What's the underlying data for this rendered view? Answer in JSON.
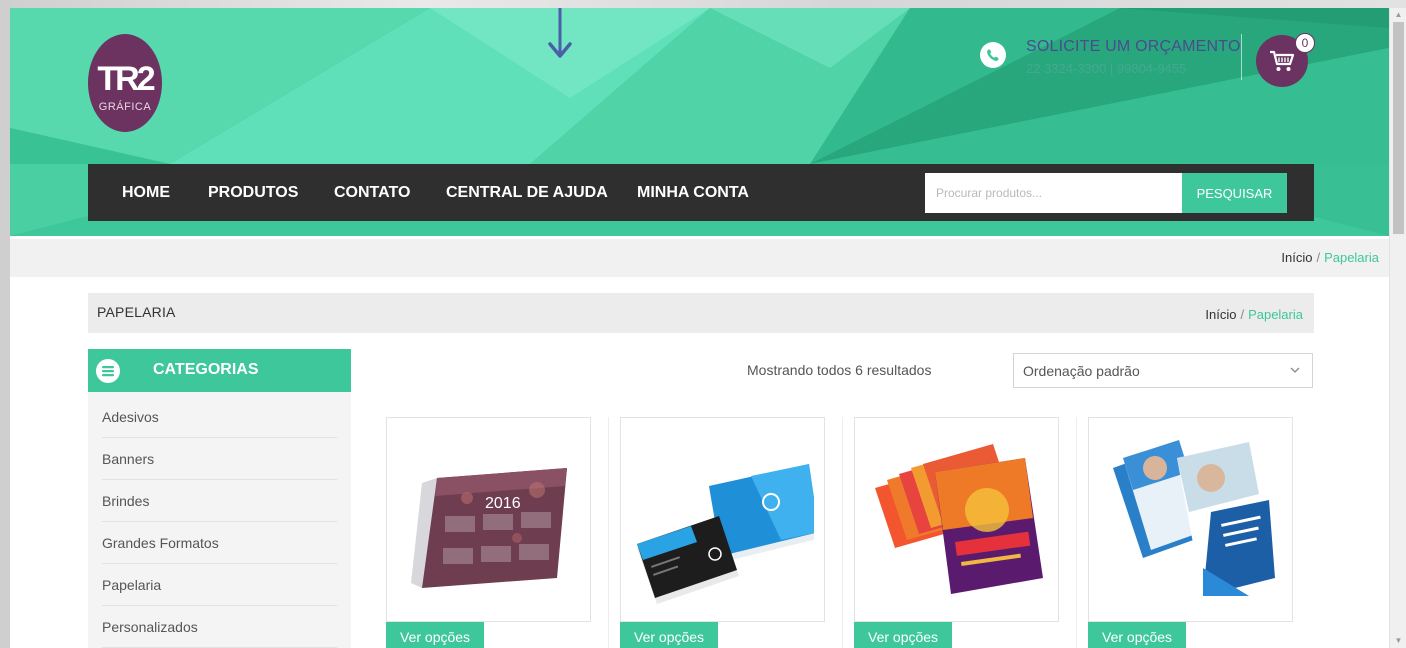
{
  "brand": {
    "logo_text": "TR2",
    "logo_subtext": "GRÁFICA"
  },
  "contact": {
    "title": "SOLICITE UM ORÇAMENTO",
    "phones": "22 3324-3300 | 99804-9455"
  },
  "cart": {
    "count": "0"
  },
  "nav": {
    "items": [
      {
        "label": "HOME"
      },
      {
        "label": "PRODUTOS"
      },
      {
        "label": "CONTATO"
      },
      {
        "label": "CENTRAL DE AJUDA"
      },
      {
        "label": "MINHA CONTA"
      }
    ]
  },
  "search": {
    "placeholder": "Procurar produtos...",
    "button_label": "PESQUISAR"
  },
  "breadcrumb": {
    "home": "Início",
    "separator": "/",
    "current": "Papelaria"
  },
  "page": {
    "title": "PAPELARIA"
  },
  "sidebar": {
    "title": "CATEGORIAS",
    "items": [
      {
        "label": "Adesivos"
      },
      {
        "label": "Banners"
      },
      {
        "label": "Brindes"
      },
      {
        "label": "Grandes Formatos"
      },
      {
        "label": "Papelaria"
      },
      {
        "label": "Personalizados"
      }
    ]
  },
  "shop": {
    "result_count": "Mostrando todos 6 resultados",
    "sort_selected": "Ordenação padrão"
  },
  "products": [
    {
      "image": "desk-calendar-2016",
      "calendar_year": "2016",
      "action_label": "Ver opções"
    },
    {
      "image": "business-cards",
      "action_label": "Ver opções"
    },
    {
      "image": "party-flyers",
      "action_label": "Ver opções"
    },
    {
      "image": "business-flyers",
      "action_label": "Ver opções"
    }
  ],
  "colors": {
    "brand_green": "#3ec79b",
    "brand_purple": "#6b3361",
    "nav_dark": "#2f2f2f"
  },
  "icons": [
    "phone-icon",
    "cart-icon",
    "menu-icon",
    "chevron-down-icon",
    "arrow-down-icon"
  ]
}
